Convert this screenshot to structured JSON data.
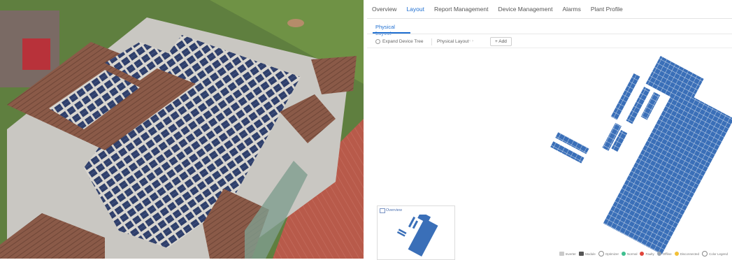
{
  "nav": {
    "tabs": [
      {
        "label": "Overview",
        "active": false
      },
      {
        "label": "Layout",
        "active": true
      },
      {
        "label": "Report Management",
        "active": false
      },
      {
        "label": "Device Management",
        "active": false
      },
      {
        "label": "Alarms",
        "active": false
      },
      {
        "label": "Plant Profile",
        "active": false
      }
    ]
  },
  "subtabs": {
    "active_label": "Physical Layout"
  },
  "toolbar": {
    "expand_label": "Expand Device Tree",
    "layout_label": "Physical Layout",
    "add_label": "+ Add"
  },
  "overview": {
    "title": "Overview"
  },
  "legend": {
    "items": [
      {
        "label": "Inverter",
        "icon": "inverter-icon",
        "color": "#c9c9c9"
      },
      {
        "label": "Module",
        "icon": "module-icon",
        "color": "#555555"
      },
      {
        "label": "Optimizer",
        "icon": "optimizer-icon",
        "color": "#8c8c8c"
      },
      {
        "label": "Normal",
        "icon": "normal-icon",
        "color": "#3fbf8f"
      },
      {
        "label": "Faulty",
        "icon": "faulty-icon",
        "color": "#e0453a"
      },
      {
        "label": "Offline",
        "icon": "offline-icon",
        "color": "#9aa3ad"
      },
      {
        "label": "Disconnected",
        "icon": "disconnected-icon",
        "color": "#f2c037"
      },
      {
        "label": "Color Legend",
        "icon": "color-legend-icon",
        "color": "#888888"
      }
    ]
  },
  "colors": {
    "accent": "#1f6fd1",
    "panel_blue": "#3a6fb8"
  }
}
